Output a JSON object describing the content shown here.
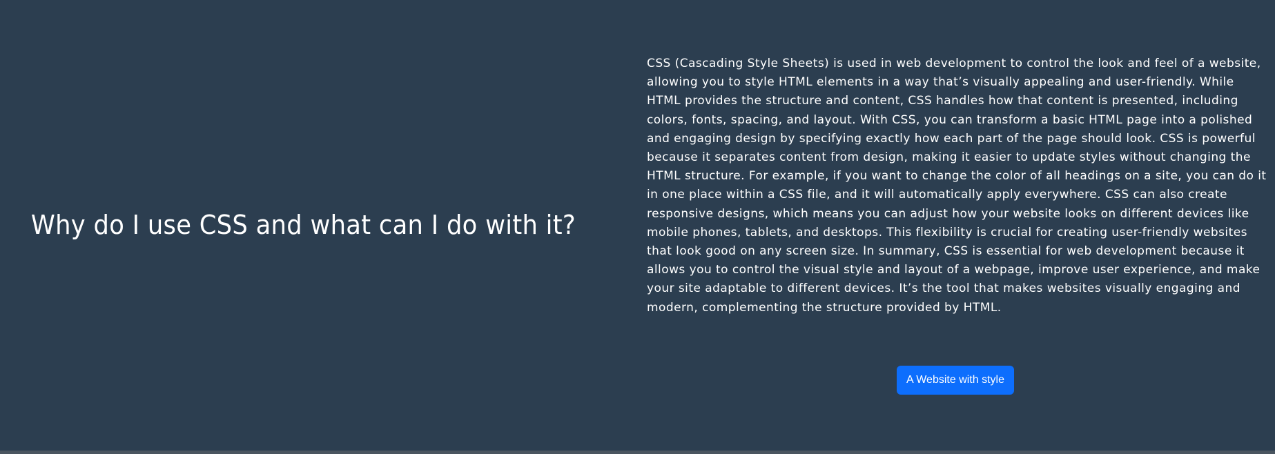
{
  "hero": {
    "heading": "Why do I use CSS and what can I do with it?",
    "paragraph": "CSS (Cascading Style Sheets) is used in web development to control the look and feel of a website, allowing you to style HTML elements in a way that’s visually appealing and user-friendly. While HTML provides the structure and content, CSS handles how that content is presented, including colors, fonts, spacing, and layout. With CSS, you can transform a basic HTML page into a polished and engaging design by specifying exactly how each part of the page should look. CSS is powerful because it separates content from design, making it easier to update styles without changing the HTML structure. For example, if you want to change the color of all headings on a site, you can do it in one place within a CSS file, and it will automatically apply everywhere. CSS can also create responsive designs, which means you can adjust how your website looks on different devices like mobile phones, tablets, and desktops. This flexibility is crucial for creating user-friendly websites that look good on any screen size. In summary, CSS is essential for web development because it allows you to control the visual style and layout of a webpage, improve user experience, and make your site adaptable to different devices. It’s the tool that makes websites visually engaging and modern, complementing the structure provided by HTML.",
    "button_label": "A Website with style"
  },
  "colors": {
    "background": "#2c3e50",
    "text": "#ffffff",
    "button": "#0d6efd"
  }
}
